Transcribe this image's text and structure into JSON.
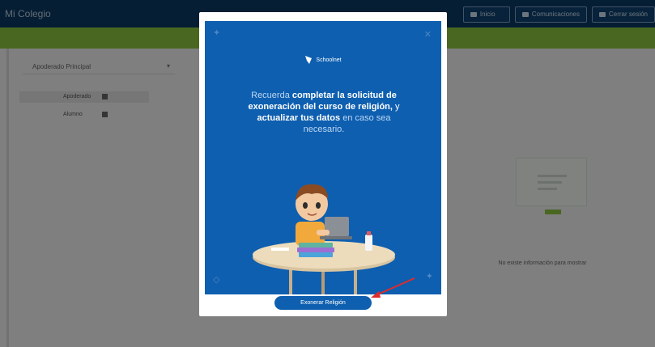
{
  "app": {
    "title": "Mi Colegio",
    "header_buttons": [
      {
        "label": "Inicio",
        "icon": "home-icon"
      },
      {
        "label": "Comunicaciones",
        "icon": "mail-icon"
      },
      {
        "label": "Cerrar sesión",
        "icon": "logout-icon"
      }
    ],
    "filter": {
      "label": "Apoderado Principal",
      "chevron": "▾"
    },
    "mini_rows": [
      {
        "label": "Apoderado"
      },
      {
        "label": "Alumno"
      }
    ],
    "placeholder_text": "No existe información para mostrar"
  },
  "modal": {
    "brand": "Schoolnet",
    "message": {
      "intro": "Recuerda ",
      "bold1": "completar la solicitud de exoneración del curso de religión,",
      "mid": " y ",
      "bold2": "actualizar tus datos",
      "outro": " en caso sea necesario."
    },
    "cta_label": "Exonerar Religión"
  },
  "colors": {
    "topbar": "#0d3a63",
    "greenbar": "#8cc63f",
    "poster_blue": "#0e5fb0",
    "annotation_red": "#e02b2b"
  }
}
